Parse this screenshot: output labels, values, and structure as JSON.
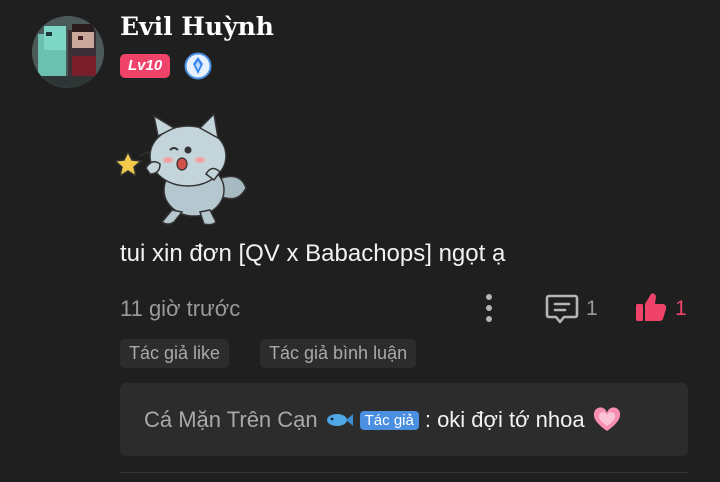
{
  "post": {
    "username": "Evil Huỳnh",
    "level_badge": "Lv10",
    "text": "tui xin đơn [QV x Babachops] ngọt ạ",
    "time": "11 giờ trước",
    "comment_count": "1",
    "like_count": "1",
    "icons": [
      "more-vertical-icon",
      "comment-icon",
      "thumbs-up-icon",
      "rank-badge-icon"
    ]
  },
  "tags": {
    "author_like": "Tác giả like",
    "author_comment": "Tác giả bình luận"
  },
  "reply": {
    "author": "Cá Mặn Trên Cạn",
    "author_badge": "Tác giả",
    "text": ": oki đợi tớ nhoa",
    "icons": [
      "fish-icon",
      "heart-icon"
    ]
  },
  "colors": {
    "background": "#1f1f1f",
    "accent_pink": "#f0436a",
    "badge_blue": "#4a8fe0",
    "muted_text": "#9a9a9a",
    "chip_bg": "#2c2c2c"
  }
}
